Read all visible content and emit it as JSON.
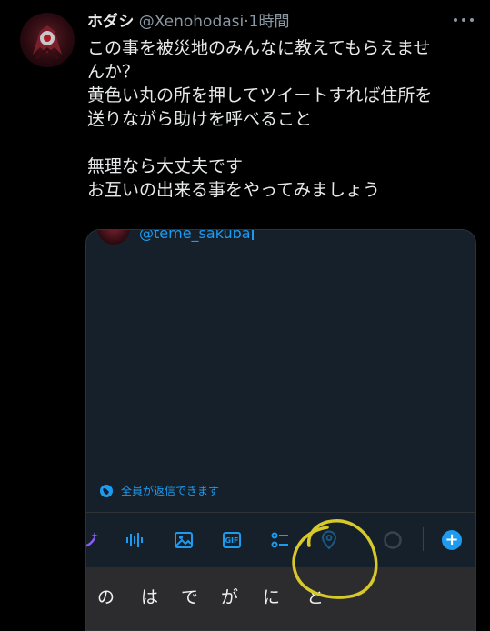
{
  "tweet": {
    "display_name": "ホダシ",
    "handle": "@Xenohodasi",
    "separator": "·",
    "time": "1時間",
    "text_lines": [
      "この事を被災地のみんなに教えてもらえませ",
      "んか？",
      "黄色い丸の所を押してツイートすれば住所を",
      "送りながら助けを呼べること",
      "",
      "無理なら大丈夫です",
      "お互いの出来る事をやってみましょう"
    ]
  },
  "screenshot": {
    "mention": "@teme_sakuba",
    "reply_setting": "全員が返信できます",
    "toolbar_icons": [
      "sparkle-icon",
      "audio-wave-icon",
      "image-icon",
      "gif-icon",
      "poll-icon",
      "location-pin-icon",
      "progress-circle-icon",
      "add-thread-icon"
    ],
    "gif_label": "GIF",
    "plus_label": "+",
    "keyboard_suggestions": [
      "の",
      "は",
      "で",
      "が",
      "に",
      "と"
    ]
  },
  "colors": {
    "accent": "#1d9bf0",
    "annotation": "#d8c92a",
    "background": "#000000",
    "card": "#15202b"
  }
}
